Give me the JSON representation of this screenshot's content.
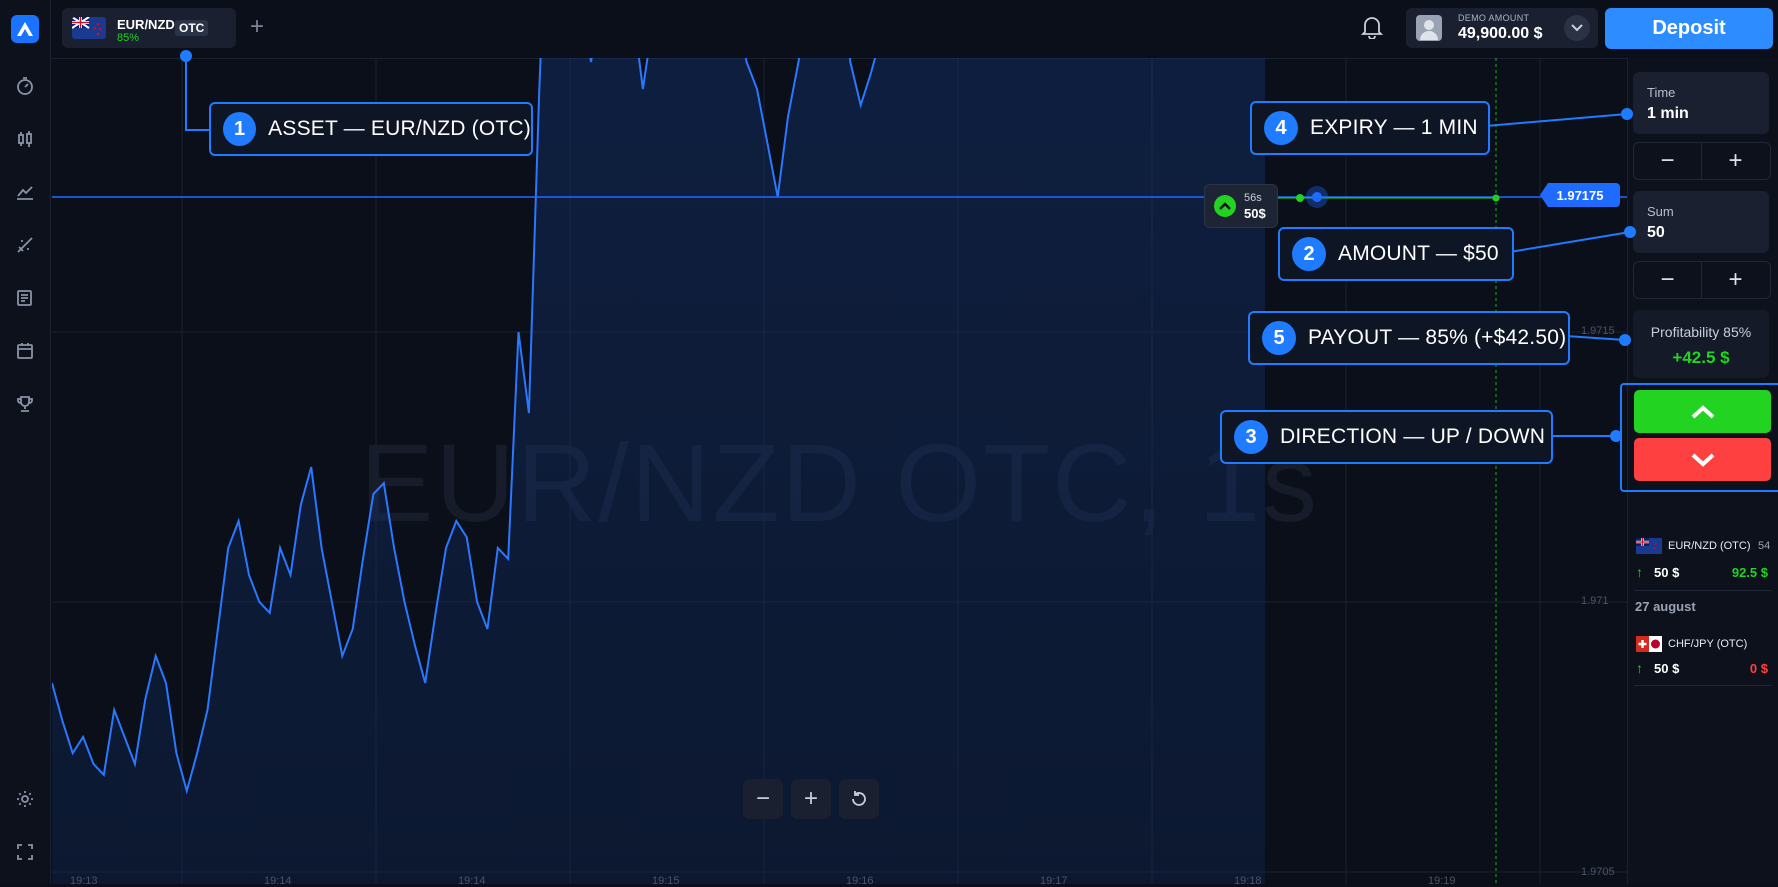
{
  "topbar": {
    "asset_name": "EUR/NZD",
    "asset_payout": "85%",
    "asset_badge": "OTC",
    "add_tab_label": "+",
    "balance_label": "DEMO AMOUNT",
    "balance_value": "49,900.00 $",
    "deposit_label": "Deposit"
  },
  "chart": {
    "watermark": "EUR/NZD OTC, 1s",
    "current_price": "1.97175",
    "price_ticks": [
      "1.9715",
      "1.971",
      "1.9705"
    ],
    "time_ticks": [
      "19:13",
      "19:14",
      "19:14",
      "19:15",
      "19:16",
      "19:17",
      "19:18",
      "19:19"
    ],
    "order_marker": {
      "time_left": "56s",
      "amount": "50$"
    },
    "zoom_out_label": "−",
    "zoom_in_label": "+"
  },
  "chart_data": {
    "type": "area",
    "series": [
      {
        "values": [
          1.97085,
          1.97078,
          1.97072,
          1.97075,
          1.9707,
          1.97068,
          1.9708,
          1.97075,
          1.9707,
          1.97082,
          1.9709,
          1.97085,
          1.97072,
          1.97065,
          1.97072,
          1.9708,
          1.97095,
          1.9711,
          1.97115,
          1.97105,
          1.971,
          1.97098,
          1.9711,
          1.97105,
          1.97118,
          1.97125,
          1.9711,
          1.971,
          1.9709,
          1.97095,
          1.97108,
          1.9712,
          1.97122,
          1.9711,
          1.971,
          1.97092,
          1.97085,
          1.97098,
          1.9711,
          1.97115,
          1.97112,
          1.971,
          1.97095,
          1.9711,
          1.97108,
          1.9715,
          1.97135,
          1.97195,
          1.9724,
          1.97255,
          1.9723,
          1.9721,
          1.972,
          1.97215,
          1.9724,
          1.97225,
          1.9721,
          1.97195,
          1.97208,
          1.9722,
          1.97245,
          1.97275,
          1.97285,
          1.973,
          1.97315,
          1.9723,
          1.9721,
          1.972,
          1.97195,
          1.97185,
          1.97175,
          1.9719,
          1.972,
          1.97215,
          1.9724,
          1.9725,
          1.9723,
          1.972,
          1.97192,
          1.97198,
          1.97205,
          1.9722,
          1.97245,
          1.97275,
          1.973,
          1.9733,
          1.9735,
          1.97345,
          1.97325,
          1.9729,
          1.9728,
          1.97285,
          1.973,
          1.9732,
          1.97315,
          1.9733,
          1.97355,
          1.9737,
          1.97362,
          1.9733,
          1.9731,
          1.9729,
          1.9727,
          1.9728,
          1.97305,
          1.9734,
          1.97355,
          1.97375,
          1.9742,
          1.9743,
          1.9741,
          1.9738,
          1.9735,
          1.9734,
          1.9723,
          1.9726,
          1.973,
          1.9726
        ],
        "x_start": "19:13",
        "x_end": "19:18"
      }
    ],
    "xlabel": "",
    "ylabel": "",
    "current_value": 1.97175,
    "yticks": [
      1.9715,
      1.971,
      1.9705
    ]
  },
  "callouts": [
    {
      "num": "1",
      "text": "ASSET — EUR/NZD (OTC)"
    },
    {
      "num": "2",
      "text": "AMOUNT — $50"
    },
    {
      "num": "3",
      "text": "DIRECTION — UP / DOWN"
    },
    {
      "num": "4",
      "text": "EXPIRY — 1 MIN"
    },
    {
      "num": "5",
      "text": "PAYOUT — 85% (+$42.50)"
    }
  ],
  "panel": {
    "time_label": "Time",
    "time_value": "1 min",
    "sum_label": "Sum",
    "sum_value": "50",
    "minus": "−",
    "plus": "+",
    "profit_label": "Profitability 85%",
    "profit_value": "+42.5 $"
  },
  "trades": {
    "open": {
      "asset": "EUR/NZD (OTC)",
      "timer": "54",
      "amount": "50 $",
      "payout": "92.5 $"
    },
    "date_header": "27 august",
    "closed": {
      "asset": "CHF/JPY (OTC)",
      "amount": "50 $",
      "payout": "0 $"
    }
  },
  "colors": {
    "accent": "#2d8cff",
    "up": "#22d322",
    "down": "#ff4040",
    "line": "#2a78ff"
  },
  "icons": [
    "logo-icon",
    "timer-icon",
    "candles-icon",
    "trades-icon",
    "analytics-icon",
    "news-icon",
    "calendar-icon",
    "trophy-icon",
    "settings-icon",
    "fullscreen-icon",
    "bell-icon",
    "avatar-icon",
    "chevron-down-icon",
    "reset-icon"
  ]
}
